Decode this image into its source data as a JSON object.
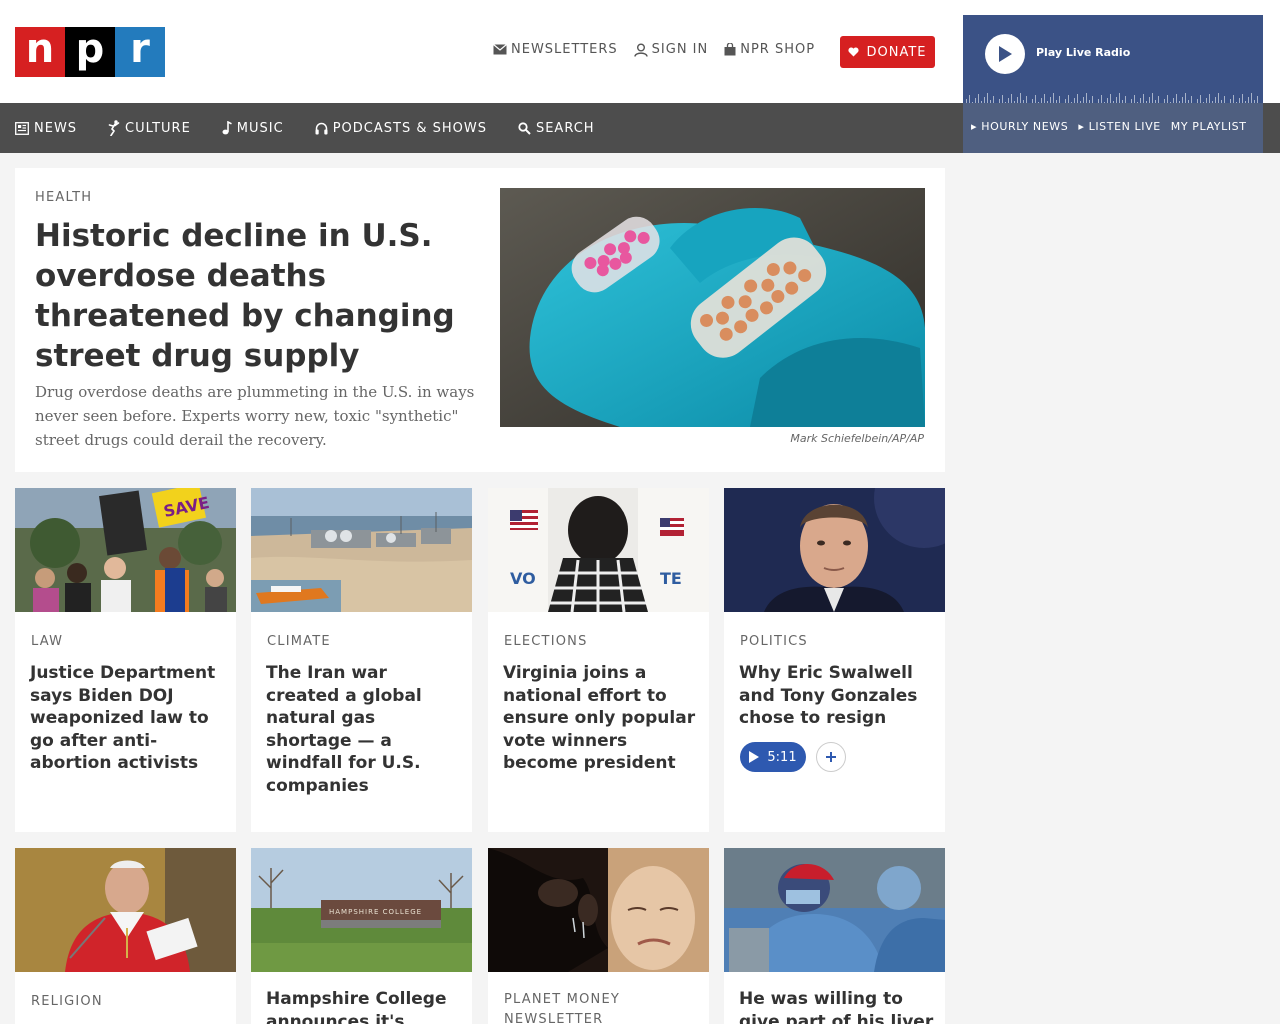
{
  "logo": {
    "n": "n",
    "p": "p",
    "r": "r"
  },
  "utility": {
    "newsletters": "NEWSLETTERS",
    "sign_in": "SIGN IN",
    "shop": "NPR SHOP",
    "donate": "DONATE"
  },
  "player": {
    "play_label": "Play Live Radio",
    "links": [
      "HOURLY NEWS",
      "LISTEN LIVE",
      "MY PLAYLIST"
    ]
  },
  "nav": {
    "items": [
      "NEWS",
      "CULTURE",
      "MUSIC",
      "PODCASTS & SHOWS",
      "SEARCH"
    ]
  },
  "lead": {
    "kicker": "HEALTH",
    "title": "Historic decline in U.S. overdose deaths threatened by changing street drug supply",
    "teaser": "Drug overdose deaths are plummeting in the U.S. in ways never seen before. Experts worry new, toxic \"synthetic\" street drugs could derail the recovery.",
    "credit": "Mark Schiefelbein/AP/AP"
  },
  "cards": [
    {
      "kicker": "LAW",
      "title": "Justice Department says Biden DOJ weaponized law to go after anti-abortion activists"
    },
    {
      "kicker": "CLIMATE",
      "title": "The Iran war created a global natural gas shortage — a windfall for U.S. companies"
    },
    {
      "kicker": "ELECTIONS",
      "title": "Virginia joins a national effort to ensure only popular vote winners become president"
    },
    {
      "kicker": "POLITICS",
      "title": "Why Eric Swalwell and Tony Gonzales chose to resign",
      "audio_duration": "5:11"
    }
  ],
  "cards_row2": [
    {
      "kicker": "RELIGION",
      "title": ""
    },
    {
      "kicker": "",
      "title": "Hampshire College announces it's closing"
    },
    {
      "kicker": "PLANET MONEY NEWSLETTER",
      "title": ""
    },
    {
      "kicker": "",
      "title": "He was willing to give part of his liver to a"
    }
  ],
  "image_text": {
    "vote_left": "VO",
    "vote_right": "TE",
    "save_sign": "SAVE",
    "college_sign": "HAMPSHIRE COLLEGE"
  },
  "colors": {
    "npr_red": "#d62021",
    "npr_black": "#000000",
    "npr_blue": "#237bbd",
    "nav_bg": "#4d4d4d",
    "player_bg": "#3b5286",
    "audio_blue": "#2e59b0"
  },
  "icons": [
    "envelope-icon",
    "user-icon",
    "bag-icon",
    "heart-icon",
    "play-icon",
    "newspaper-icon",
    "culture-icon",
    "music-note-icon",
    "headphones-icon",
    "search-icon",
    "plus-icon"
  ]
}
